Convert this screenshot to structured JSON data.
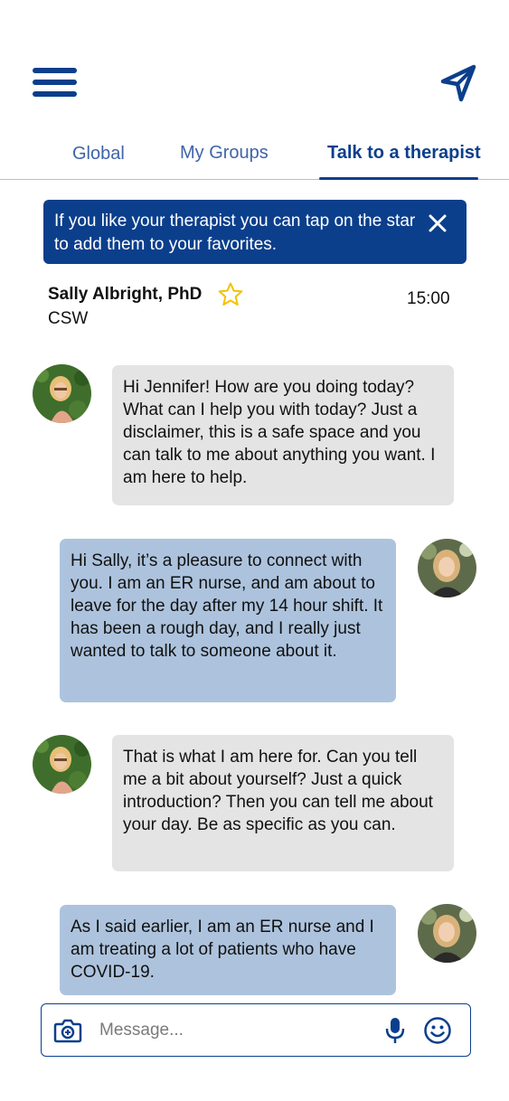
{
  "header": {
    "menu_icon": "hamburger-menu-icon",
    "send_icon": "paper-plane-icon"
  },
  "tabs": [
    {
      "label": "Global",
      "active": false
    },
    {
      "label": "My Groups",
      "active": false
    },
    {
      "label": "Talk to a therapist",
      "active": true
    }
  ],
  "banner": {
    "text": "If you like your therapist you can tap on the star to add them to your favorites.",
    "close_icon": "close-icon"
  },
  "therapist": {
    "name": "Sally Albright, PhD",
    "role": "CSW",
    "favorite_icon": "star-outline-icon",
    "session_time": "15:00"
  },
  "messages": [
    {
      "from": "therapist",
      "text": "Hi Jennifer! How are you doing today? What can I help you with today? Just a disclaimer, this is a safe space and you can talk to me about anything you want. I am here to help."
    },
    {
      "from": "user",
      "text": "Hi Sally, it’s a pleasure to connect with you. I am an ER nurse, and am about to leave for the day after my 14 hour shift. It has been a rough day, and I really just wanted to talk to someone about it."
    },
    {
      "from": "therapist",
      "text": "That is what I am here for. Can you tell me a bit about yourself? Just a quick introduction? Then you can tell me about your day. Be as specific as you can."
    },
    {
      "from": "user",
      "text": "As I said earlier, I am an ER nurse and I am treating a lot of patients who have COVID-19."
    }
  ],
  "composer": {
    "placeholder": "Message...",
    "value": "",
    "camera_icon": "camera-icon",
    "mic_icon": "microphone-icon",
    "emoji_icon": "smiley-icon"
  },
  "colors": {
    "brand": "#0b3f8c",
    "tab_inactive": "#3f64a8",
    "bubble_incoming": "#e4e4e4",
    "bubble_outgoing": "#adc3dd",
    "star": "#f2c200"
  }
}
